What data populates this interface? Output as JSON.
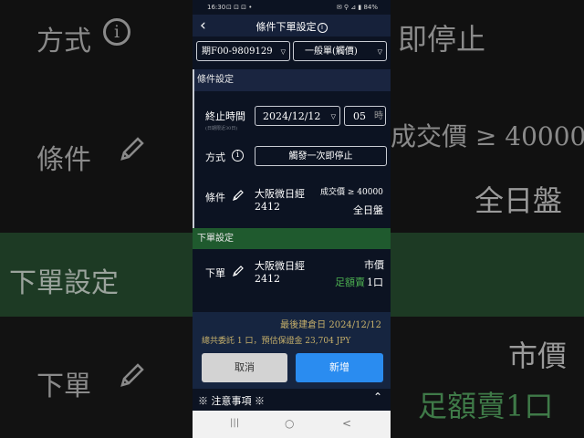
{
  "status_bar": {
    "time": "16:30",
    "icons": "⊡ ⊡ ⊡ •",
    "battery": "84%",
    "signal_icons": "✉ ⚲ ⊿ ▮"
  },
  "header": {
    "title": "條件下單設定",
    "info_icon": "info-circle-icon",
    "back_icon": "chevron-left-icon"
  },
  "selectors": {
    "account": "期F00-9809129",
    "order_type": "一般單(觸價)"
  },
  "condition_section": {
    "title": "條件設定",
    "end_time_label": "終止時間",
    "end_time_note": "(日期限近30日)",
    "end_date": "2024/12/12",
    "end_hour": "05",
    "hour_unit": "時",
    "method_label": "方式",
    "method_value": "觸發一次即停止",
    "condition_label": "條件",
    "product_name": "大阪微日經",
    "product_code": "2412",
    "condition_text": "成交價 ≥ 40000",
    "session": "全日盤"
  },
  "order_section": {
    "title": "下單設定",
    "order_label": "下單",
    "product_name": "大阪微日經",
    "product_code": "2412",
    "price_type": "市價",
    "side": "足額賣",
    "quantity": "1口"
  },
  "summary": {
    "last_trade_date": "最後建倉日 2024/12/12",
    "total": "總共委託 1 口，預估保證金 23,704 JPY"
  },
  "buttons": {
    "cancel": "取消",
    "add": "新增"
  },
  "notice": {
    "title": "※ 注意事項 ※",
    "toggle_icon": "chevron-up-icon"
  },
  "nav": {
    "recent": "|||",
    "home": "○",
    "back": "<"
  },
  "background": {
    "method": "方式",
    "stop": "即停止",
    "condition": "條件",
    "price_cond": "成交價 ≥ 40000",
    "session": "全日盤",
    "order_setting": "下單設定",
    "order": "下單",
    "market": "市價",
    "sell": "足額賣1口"
  },
  "colors": {
    "phone_bg": "#0c1322",
    "header_bg": "#16213a",
    "section_green": "#1f5a2e",
    "add_button": "#2a8cf0",
    "cancel_button": "#d3d3d3",
    "side_green": "#4caf50"
  }
}
